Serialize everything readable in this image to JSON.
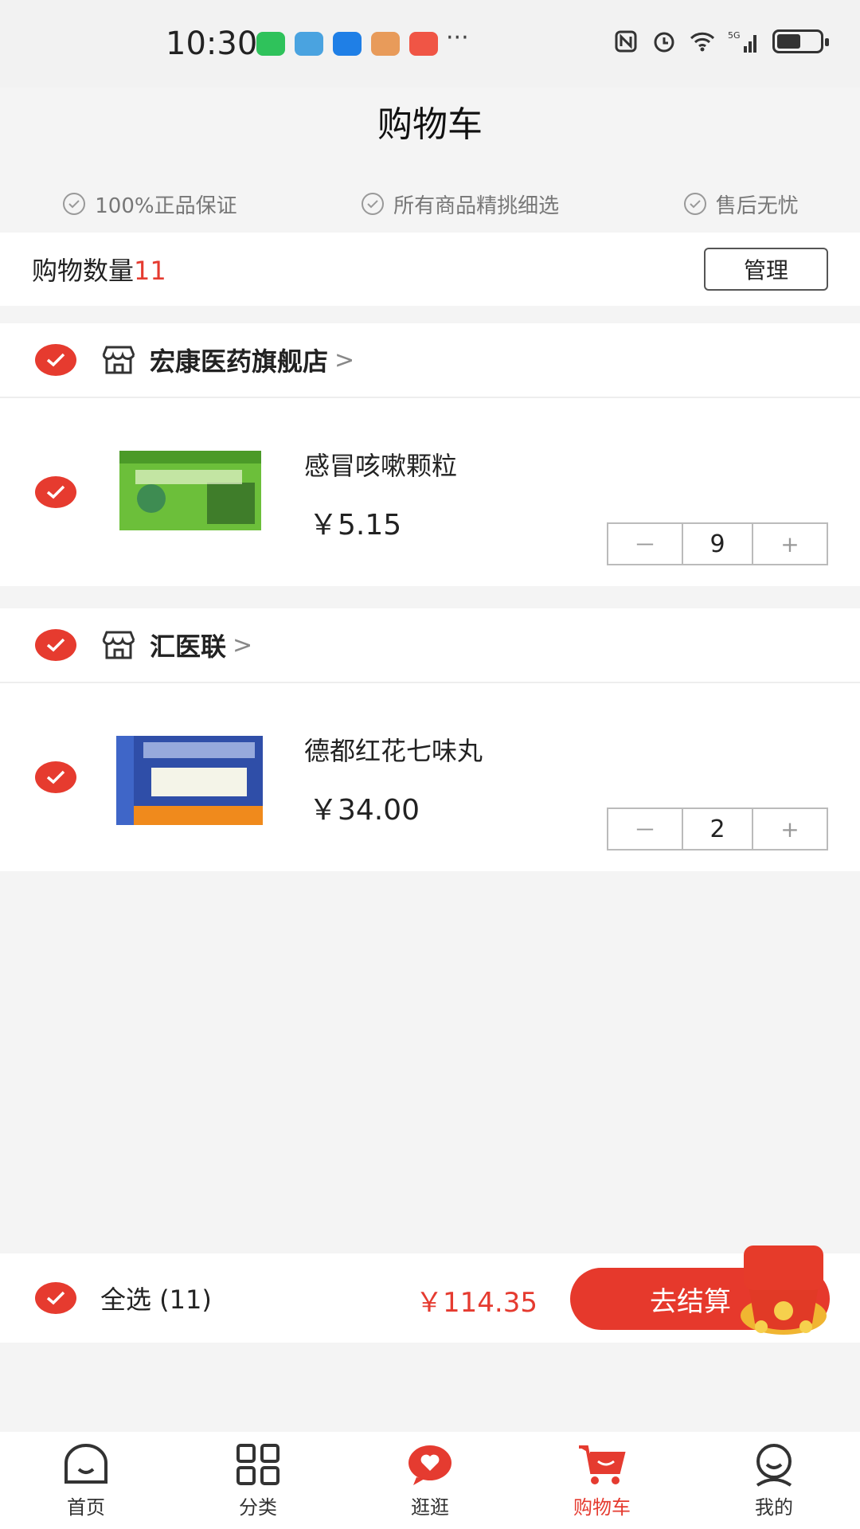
{
  "status_bar": {
    "time": "10:30",
    "more": "···",
    "network": "5G",
    "app_icons": [
      "wechat-icon",
      "browser-icon",
      "shield-icon",
      "message-icon",
      "wallet-icon"
    ]
  },
  "page": {
    "title": "购物车"
  },
  "guarantees": [
    {
      "label": "100%正品保证"
    },
    {
      "label": "所有商品精挑细选"
    },
    {
      "label": "售后无忧"
    }
  ],
  "cart": {
    "count_label": "购物数量",
    "count": "11",
    "manage_label": "管理"
  },
  "stores": [
    {
      "name": "宏康医药旗舰店",
      "chevron": ">",
      "products": [
        {
          "name": "感冒咳嗽颗粒",
          "price": "￥5.15",
          "quantity": "9",
          "minus": "－",
          "plus": "+"
        }
      ]
    },
    {
      "name": "汇医联",
      "chevron": ">",
      "products": [
        {
          "name": "德都红花七味丸",
          "price": "￥34.00",
          "quantity": "2",
          "minus": "－",
          "plus": "+"
        }
      ]
    }
  ],
  "bottom_bar": {
    "select_all": "全选 (11)",
    "total": "￥114.35",
    "checkout": "去结算"
  },
  "tabs": [
    {
      "label": "首页",
      "icon": "home-face-icon",
      "active": false
    },
    {
      "label": "分类",
      "icon": "grid-icon",
      "active": false
    },
    {
      "label": "逛逛",
      "icon": "heart-chat-icon",
      "active": false
    },
    {
      "label": "购物车",
      "icon": "cart-icon",
      "active": true
    },
    {
      "label": "我的",
      "icon": "profile-face-icon",
      "active": false
    }
  ],
  "colors": {
    "accent": "#e53b30",
    "background": "#f4f4f4"
  }
}
